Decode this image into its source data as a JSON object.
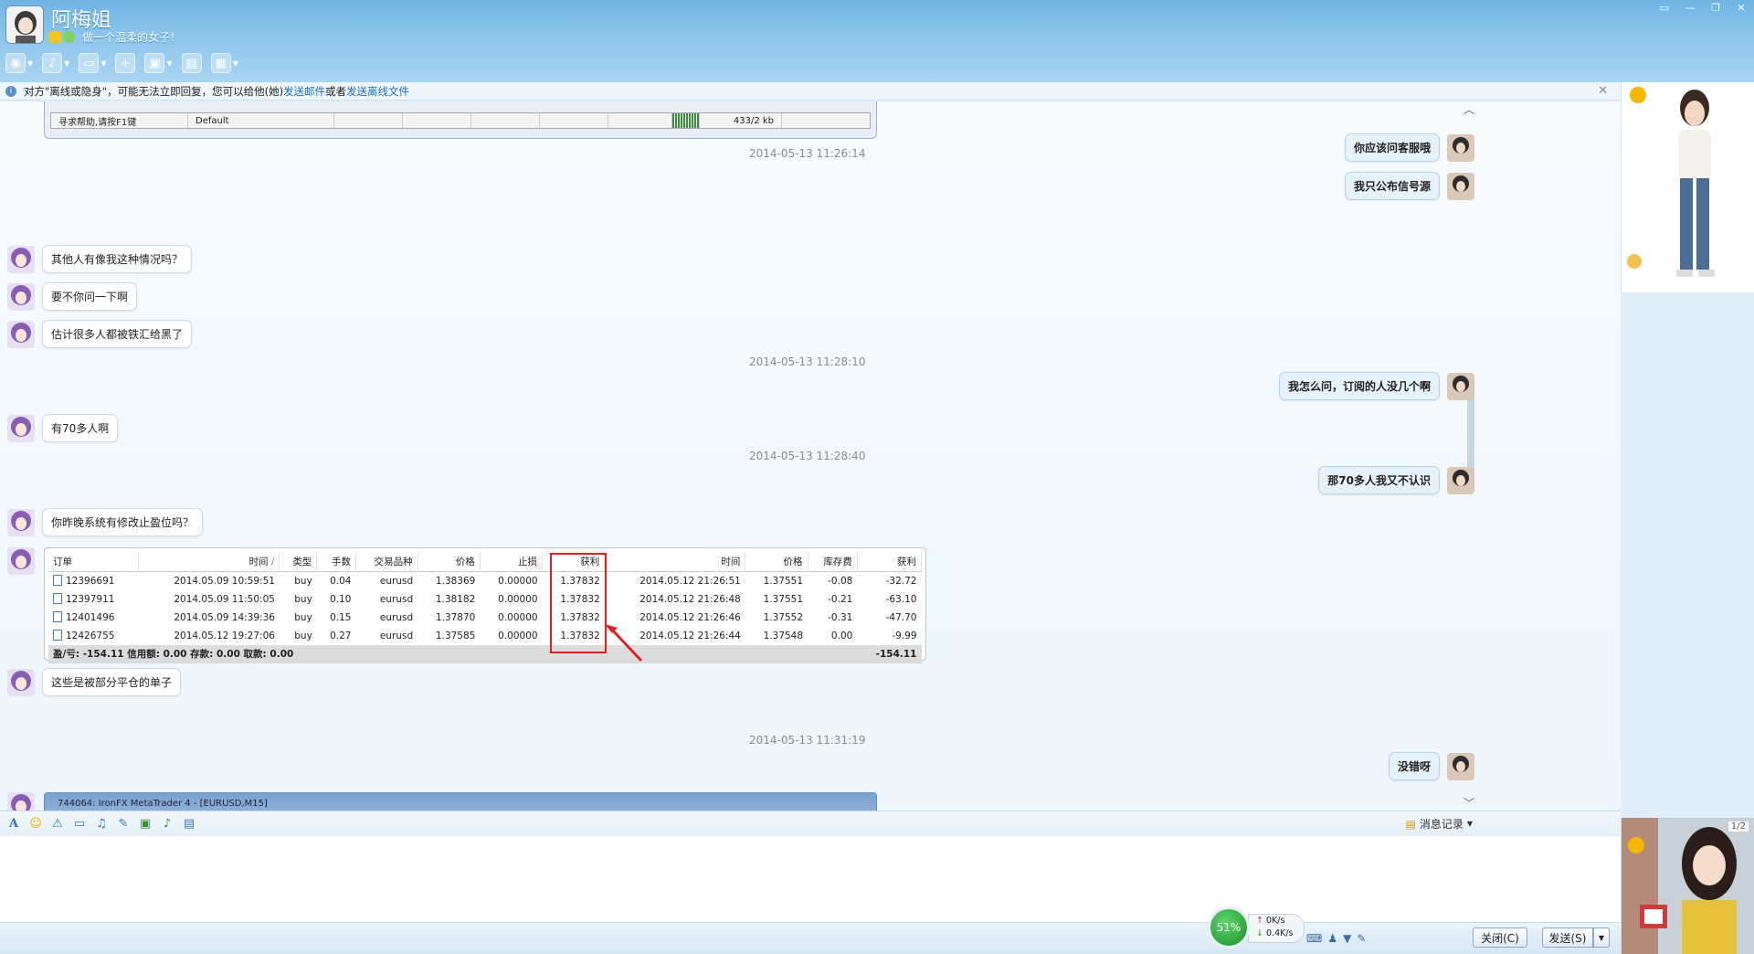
{
  "window": {
    "contact_name": "阿梅姐",
    "signature": "做一个温柔的女子！",
    "controls": [
      "▭",
      "—",
      "❐",
      "✕"
    ]
  },
  "notice": {
    "text_prefix": "对方\"离线或隐身\"，可能无法立即回复，您可以给他(她)",
    "link_email": "发送邮件",
    "text_or": "或者",
    "link_offline_file": "发送离线文件"
  },
  "screenshot_top": {
    "help_text": "寻求帮助,请按F1键",
    "profile": "Default",
    "size": "433/2 kb"
  },
  "timestamps": {
    "t1": "2014-05-13 11:26:14",
    "t2": "2014-05-13 11:28:10",
    "t3": "2014-05-13 11:28:40",
    "t4": "2014-05-13 11:31:19"
  },
  "messages": {
    "r1": "你应该问客服哦",
    "r2": "我只公布信号源",
    "l1": "其他人有像我这种情况吗？",
    "l2": "要不你问一下啊",
    "l3": "估计很多人都被铁汇给黑了",
    "r3": "我怎么问，订阅的人没几个啊",
    "l4": "有70多人啊",
    "r4": "那70多人我又不认识",
    "l5": "你昨晚系统有修改止盈位吗？",
    "l6": "这些是被部分平仓的单子",
    "r5": "没错呀"
  },
  "trades": {
    "headers": [
      "订单",
      "时间",
      "/",
      "类型",
      "手数",
      "交易品种",
      "价格",
      "止损",
      "获利",
      "时间",
      "价格",
      "库存费",
      "获利"
    ],
    "rows": [
      [
        "12396691",
        "2014.05.09 10:59:51",
        "buy",
        "0.04",
        "eurusd",
        "1.38369",
        "0.00000",
        "1.37832",
        "2014.05.12 21:26:51",
        "1.37551",
        "-0.08",
        "-32.72"
      ],
      [
        "12397911",
        "2014.05.09 11:50:05",
        "buy",
        "0.10",
        "eurusd",
        "1.38182",
        "0.00000",
        "1.37832",
        "2014.05.12 21:26:48",
        "1.37551",
        "-0.21",
        "-63.10"
      ],
      [
        "12401496",
        "2014.05.09 14:39:36",
        "buy",
        "0.15",
        "eurusd",
        "1.37870",
        "0.00000",
        "1.37832",
        "2014.05.12 21:26:46",
        "1.37552",
        "-0.31",
        "-47.70"
      ],
      [
        "12426755",
        "2014.05.12 19:27:06",
        "buy",
        "0.27",
        "eurusd",
        "1.37585",
        "0.00000",
        "1.37832",
        "2014.05.12 21:26:44",
        "1.37548",
        "0.00",
        "-9.99"
      ]
    ],
    "summary_label": "盈/亏: -154.11  信用额: 0.00  存款: 0.00  取款: 0.00",
    "summary_total": "-154.11"
  },
  "screenshot_bottom": {
    "title": "744064: IronFX MetaTrader 4 - [EURUSD,M15]"
  },
  "input_toolbar": {
    "history_label": "消息记录"
  },
  "side": {
    "pager": "1/2"
  },
  "network": {
    "percent": "51%",
    "up": "0K/s",
    "down": "0.4K/s"
  },
  "buttons": {
    "close": "关闭(C)",
    "send": "发送(S)"
  },
  "colors": {
    "accent": "#6fb4e3",
    "link": "#1e6fc8",
    "highlight": "#e02020"
  }
}
